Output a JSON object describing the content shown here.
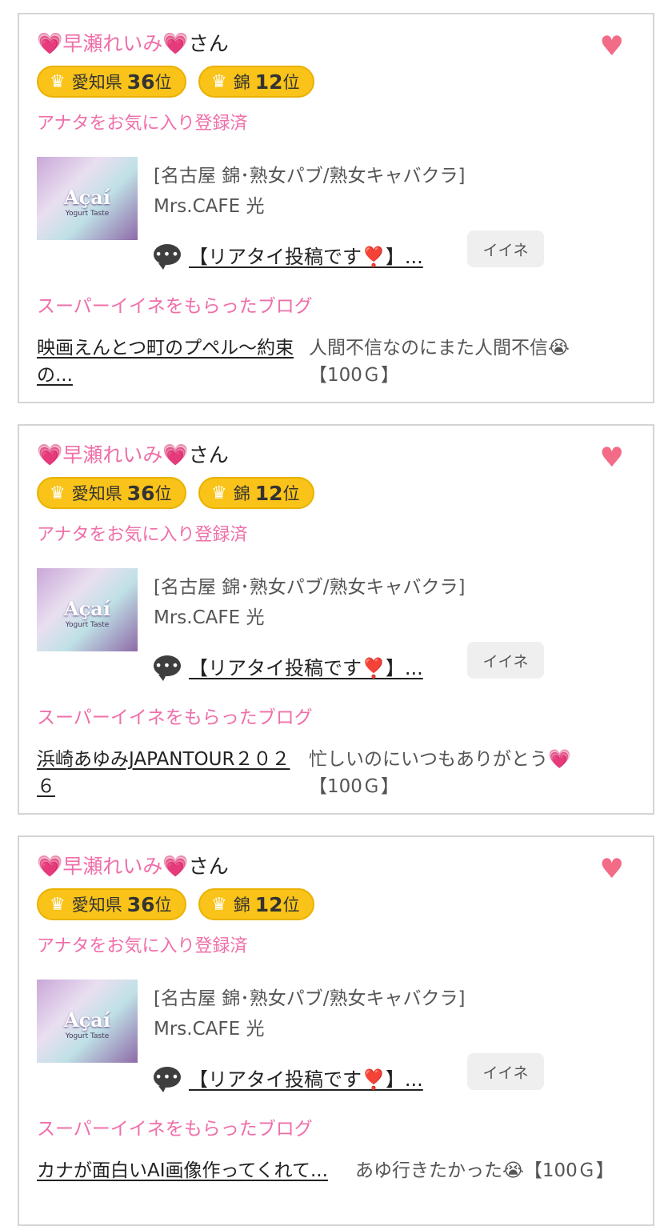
{
  "cards": [
    {
      "user_name": "早瀬れいみ",
      "honorific": "さん",
      "heart_emoji": "💗",
      "ranks": [
        {
          "area": "愛知県",
          "rank": "36",
          "unit": "位"
        },
        {
          "area": "錦",
          "rank": "12",
          "unit": "位"
        }
      ],
      "favorite_status": "アナタをお気に入り登録済",
      "thumbnail_text": "Açaí",
      "thumbnail_sub": "Yogurt Taste",
      "shop_category": "[名古屋 錦･熟女パブ/熟女キャバクラ]",
      "shop_name": "Mrs.CAFE 光",
      "post_link": "【リアタイ投稿です❣️】...",
      "iine_label": "イイネ",
      "section_title": "スーパーイイネをもらったブログ",
      "blog_title": "映画えんとつ町のプペル〜約束の...",
      "blog_comment": "人間不信なのにまた人間不信😭",
      "blog_points": "【100Ｇ】"
    },
    {
      "user_name": "早瀬れいみ",
      "honorific": "さん",
      "heart_emoji": "💗",
      "ranks": [
        {
          "area": "愛知県",
          "rank": "36",
          "unit": "位"
        },
        {
          "area": "錦",
          "rank": "12",
          "unit": "位"
        }
      ],
      "favorite_status": "アナタをお気に入り登録済",
      "thumbnail_text": "Açaí",
      "thumbnail_sub": "Yogurt Taste",
      "shop_category": "[名古屋 錦･熟女パブ/熟女キャバクラ]",
      "shop_name": "Mrs.CAFE 光",
      "post_link": "【リアタイ投稿です❣️】...",
      "iine_label": "イイネ",
      "section_title": "スーパーイイネをもらったブログ",
      "blog_title": "浜崎あゆみJAPANTOUR２０２６",
      "blog_comment": "忙しいのにいつもありがとう💗",
      "blog_points": "【100Ｇ】"
    },
    {
      "user_name": "早瀬れいみ",
      "honorific": "さん",
      "heart_emoji": "💗",
      "ranks": [
        {
          "area": "愛知県",
          "rank": "36",
          "unit": "位"
        },
        {
          "area": "錦",
          "rank": "12",
          "unit": "位"
        }
      ],
      "favorite_status": "アナタをお気に入り登録済",
      "thumbnail_text": "Açaí",
      "thumbnail_sub": "Yogurt Taste",
      "shop_category": "[名古屋 錦･熟女パブ/熟女キャバクラ]",
      "shop_name": "Mrs.CAFE 光",
      "post_link": "【リアタイ投稿です❣️】...",
      "iine_label": "イイネ",
      "section_title": "スーパーイイネをもらったブログ",
      "blog_title": "カナが面白いAI画像作ってくれて...",
      "blog_comment": "あゆ行きたかった😭",
      "blog_points": "【100Ｇ】"
    }
  ],
  "icons": {
    "favorite": "heart-icon",
    "crown": "crown-icon",
    "comment": "speech-bubble-icon"
  },
  "colors": {
    "accent_pink": "#ef6fa9",
    "heart": "#f26b87",
    "badge_gold": "#f9c319"
  }
}
